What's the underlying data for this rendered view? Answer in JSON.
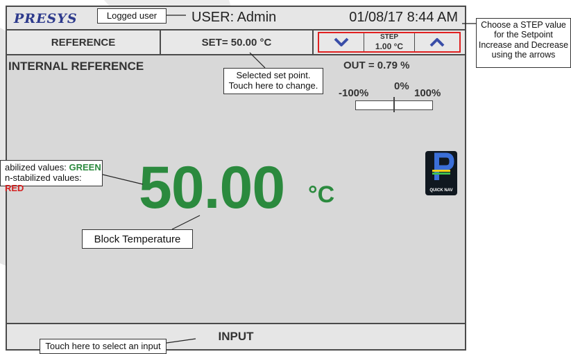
{
  "header": {
    "brand": "PRESYS",
    "user": "USER: Admin",
    "datetime": "01/08/17  8:44 AM"
  },
  "toolbar": {
    "reference_label": "REFERENCE",
    "set_label": "SET= 50.00 °C",
    "step_label": "STEP",
    "step_value": "1.00 °C"
  },
  "main": {
    "mode_title": "INTERNAL REFERENCE",
    "out_label": "OUT = 0.79 %",
    "scale_left": "-100%",
    "scale_mid": "0%",
    "scale_right": "100%",
    "out_percent": 0.79,
    "temperature": "50.00",
    "unit": "°C",
    "temperature_color": "#2b8a3e",
    "quicknav_label": "QUICK NAV"
  },
  "footer": {
    "input_label": "INPUT"
  },
  "callouts": {
    "logged_user": "Logged user",
    "step_line1": "Choose a STEP value",
    "step_line2": "for the Setpoint",
    "step_line3": "Increase and Decrease",
    "step_line4": "using the arrows",
    "set_line1": "Selected set point.",
    "set_line2": "Touch here to change.",
    "stab_prefix": "abilized values:",
    "stab_green": "GREEN",
    "unstab_prefix": "n-stabilized values:",
    "unstab_red": "RED",
    "block_temp": "Block Temperature",
    "input_hint": "Touch here to select an input"
  },
  "colors": {
    "accent_red": "#e02020",
    "arrow_blue": "#3a4ea8",
    "stable_green": "#2b8a3e",
    "unstable_red": "#d42020"
  }
}
